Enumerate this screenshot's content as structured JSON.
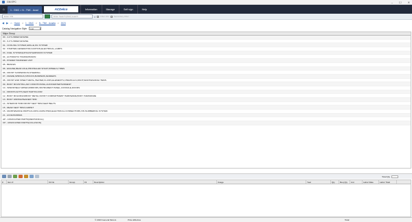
{
  "window": {
    "title": "GM EPC",
    "controls": [
      "–",
      "☐",
      "✕"
    ]
  },
  "navbar": {
    "tab_label": "1 - GMC > N - TNK - Acad",
    "brand": "ACDelco",
    "links": [
      "Information",
      "Manage",
      "Self sign",
      "Help"
    ]
  },
  "search": {
    "scope_placeholder": "Enter VIN",
    "query_placeholder": "Enter Search (Part) search",
    "opt1": "Filter Info",
    "opt2": "Secondary Filter"
  },
  "breadcrumb": [
    "Home",
    "1 - GMC",
    "N - TNK - Acadia",
    "2023"
  ],
  "style_bar": {
    "label": "Catalog Navigation Style",
    "value": "List"
  },
  "grid": {
    "header": "Major Group",
    "rows": [
      "00 - 4-CYLINDER ENGINE",
      "00 - 6-CYLINDER ENGINE",
      "01 - COOLING SYSTEM,GRILLE,OIL SYSTEM",
      "02 - STARTER,GENERATOR,IGNITION,ELECTRICAL,LAMPS",
      "03 - FUEL SYSTEM,EXHAUST,EMISSION SYSTEM",
      "04 - AUTOMATIC TRANSMISSION",
      "05 - POWER TRANSFER UNIT",
      "05 - BRAKES",
      "06 - ENGINE,REAR AXLE,PROPELLER SHAFT,WHEELS,TIRES",
      "06 - FRONT SUSPENSION,STEERING",
      "07 - FRAME,SPRINGS,SHOCKS,BUMPERS,FENDERS",
      "08 - FRONT END SHEET METAL,HEATER,FLUIDS,ELEMENTS,CHEMICALS,PAINT,MAINTENANCE ITEMS",
      "09 - BODY MOUNTING,AIR CONDITIONING,AUDIO/ENTERTAINMENT",
      "10 - WINDSHIELD WIPER,MIRRORS,INSTRUMENT PANEL,CONSOLE,DOORS",
      "11 - FRONT/LIGHTS,SEAT PART/FLOOR",
      "12 - BODY MOLDINGS/BODY METAL FRONT COMPARTMENT HARDWARE,BODY HARDWARE",
      "13 - BODY WIRING/HEADER TRIM",
      "14 - INTERIOR TRIM FRONT SEAT TRIM,SEAT BELTS",
      "15 - REAR SEAT TRIM,CARPET",
      "15 - MAINTENANCE PARTS,FLUIDS,CAPACITIES,ELECTRICAL CONNECTORS,VIN NUMBERING SYSTEM",
      "21 - ACCESSORIES",
      "AP - ASSOCIATED PARTS(MECHANICAL)",
      "CP - ASSOCIATED PARTS(COLLISION)"
    ]
  },
  "cart": {
    "toolbar_label": "Total Qty",
    "columns": [
      "#",
      "Item #",
      "Kit No",
      "Group",
      "Fil",
      "Description",
      "Usage",
      "Year",
      "Qty",
      "Req Qty",
      "List",
      "Labor Rate",
      "Labor Total"
    ]
  },
  "footer": {
    "copyright": "© 2023 General Motors",
    "filter": "Price Effective",
    "total_label": "Total:"
  }
}
